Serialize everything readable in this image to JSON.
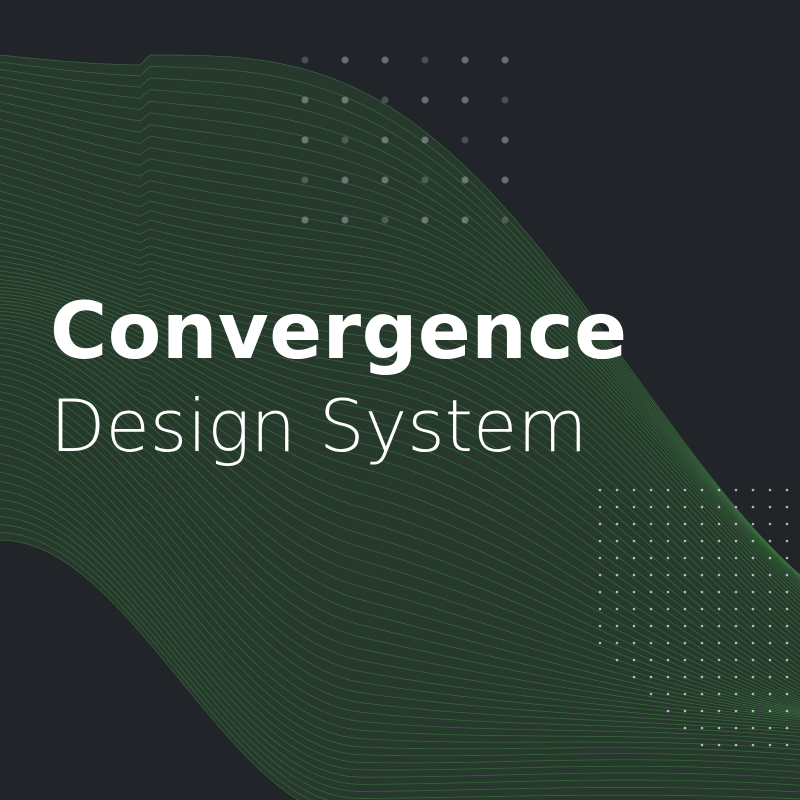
{
  "title": {
    "primary": "Convergence",
    "secondary": "Design System"
  },
  "colors": {
    "background": "#212529",
    "wave_stroke": "#3f7a43",
    "wave_fill": "#2c4a30",
    "dot": "#9aa0a6",
    "text": "#ffffff"
  },
  "decorations": {
    "wave_icon": "mesh-wave-graphic",
    "dot_grid_icon": "dot-grid-pattern"
  }
}
